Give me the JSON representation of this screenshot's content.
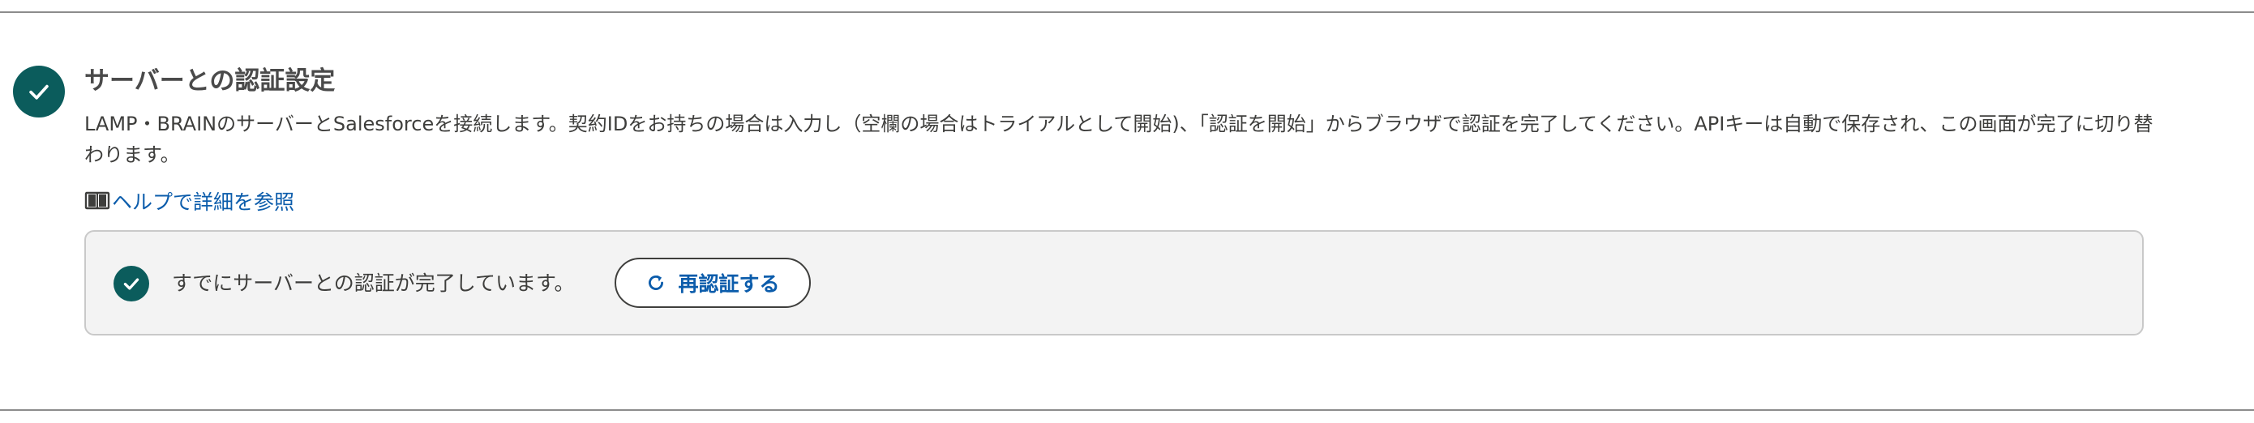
{
  "section": {
    "title": "サーバーとの認証設定",
    "description": "LAMP・BRAINのサーバーとSalesforceを接続します。契約IDをお持ちの場合は入力し（空欄の場合はトライアルとして開始)、「認証を開始」からブラウザで認証を完了してください。APIキーは自動で保存され、この画面が完了に切り替わります。",
    "step_status_icon": "check-icon",
    "help_link": {
      "icon": "book-icon",
      "label": "ヘルプで詳細を参照"
    }
  },
  "status_box": {
    "icon": "check-icon",
    "message": "すでにサーバーとの認証が完了しています。",
    "reauth_button": {
      "icon": "refresh-icon",
      "label": "再認証する"
    }
  },
  "colors": {
    "accent_teal": "#0b5c5c",
    "link_blue": "#0b5cab",
    "box_background": "#f3f3f3",
    "box_border": "#c9c9c9"
  }
}
